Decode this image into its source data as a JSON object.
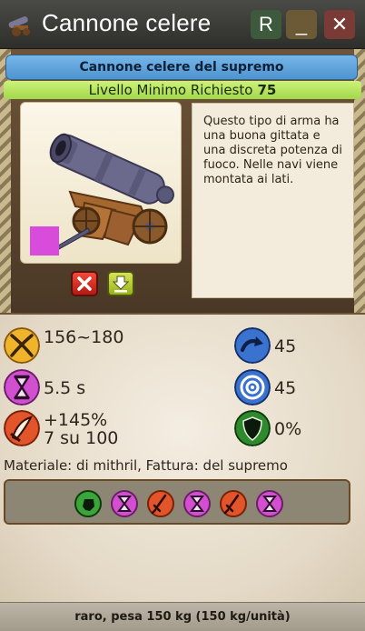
{
  "window": {
    "title": "Cannone celere",
    "buttons": {
      "r_label": "R",
      "minimize_label": "_",
      "close_label": "✕"
    }
  },
  "item": {
    "full_name": "Cannone celere del supremo",
    "level_label": "Livello Minimo Richiesto",
    "level_value": "75",
    "description": "Questo tipo di arma ha una buona gittata e una discreta potenza di fuoco. Nelle navi viene montata ai lati.",
    "quality_color": "#d94bdb"
  },
  "actions": {
    "cancel_icon": "cancel-x-icon",
    "download_icon": "down-arrow-icon"
  },
  "stats": {
    "damage": "156~180",
    "speed": "5.5 s",
    "crit_percent": "+145%",
    "crit_count": "7 su 100",
    "reload": "45",
    "accuracy": "45",
    "defense": "0%"
  },
  "material": "Materiale: di mithril, Fattura: del supremo",
  "enchantments": [
    "green-fist-icon",
    "hourglass-icon",
    "red-sword-icon",
    "hourglass-icon",
    "red-sword-icon",
    "hourglass-icon"
  ],
  "footer": "raro, pesa 150 kg (150 kg/unità)",
  "colors": {
    "name_bar": "#5fa3dc",
    "level_bar": "#b7e45e",
    "quality": "#d94bdb",
    "stat_orange": "#f0b42c",
    "stat_magenta": "#d24fcf",
    "stat_red": "#e2542a",
    "stat_blue": "#3a72d0",
    "stat_green": "#2f8a2e"
  }
}
